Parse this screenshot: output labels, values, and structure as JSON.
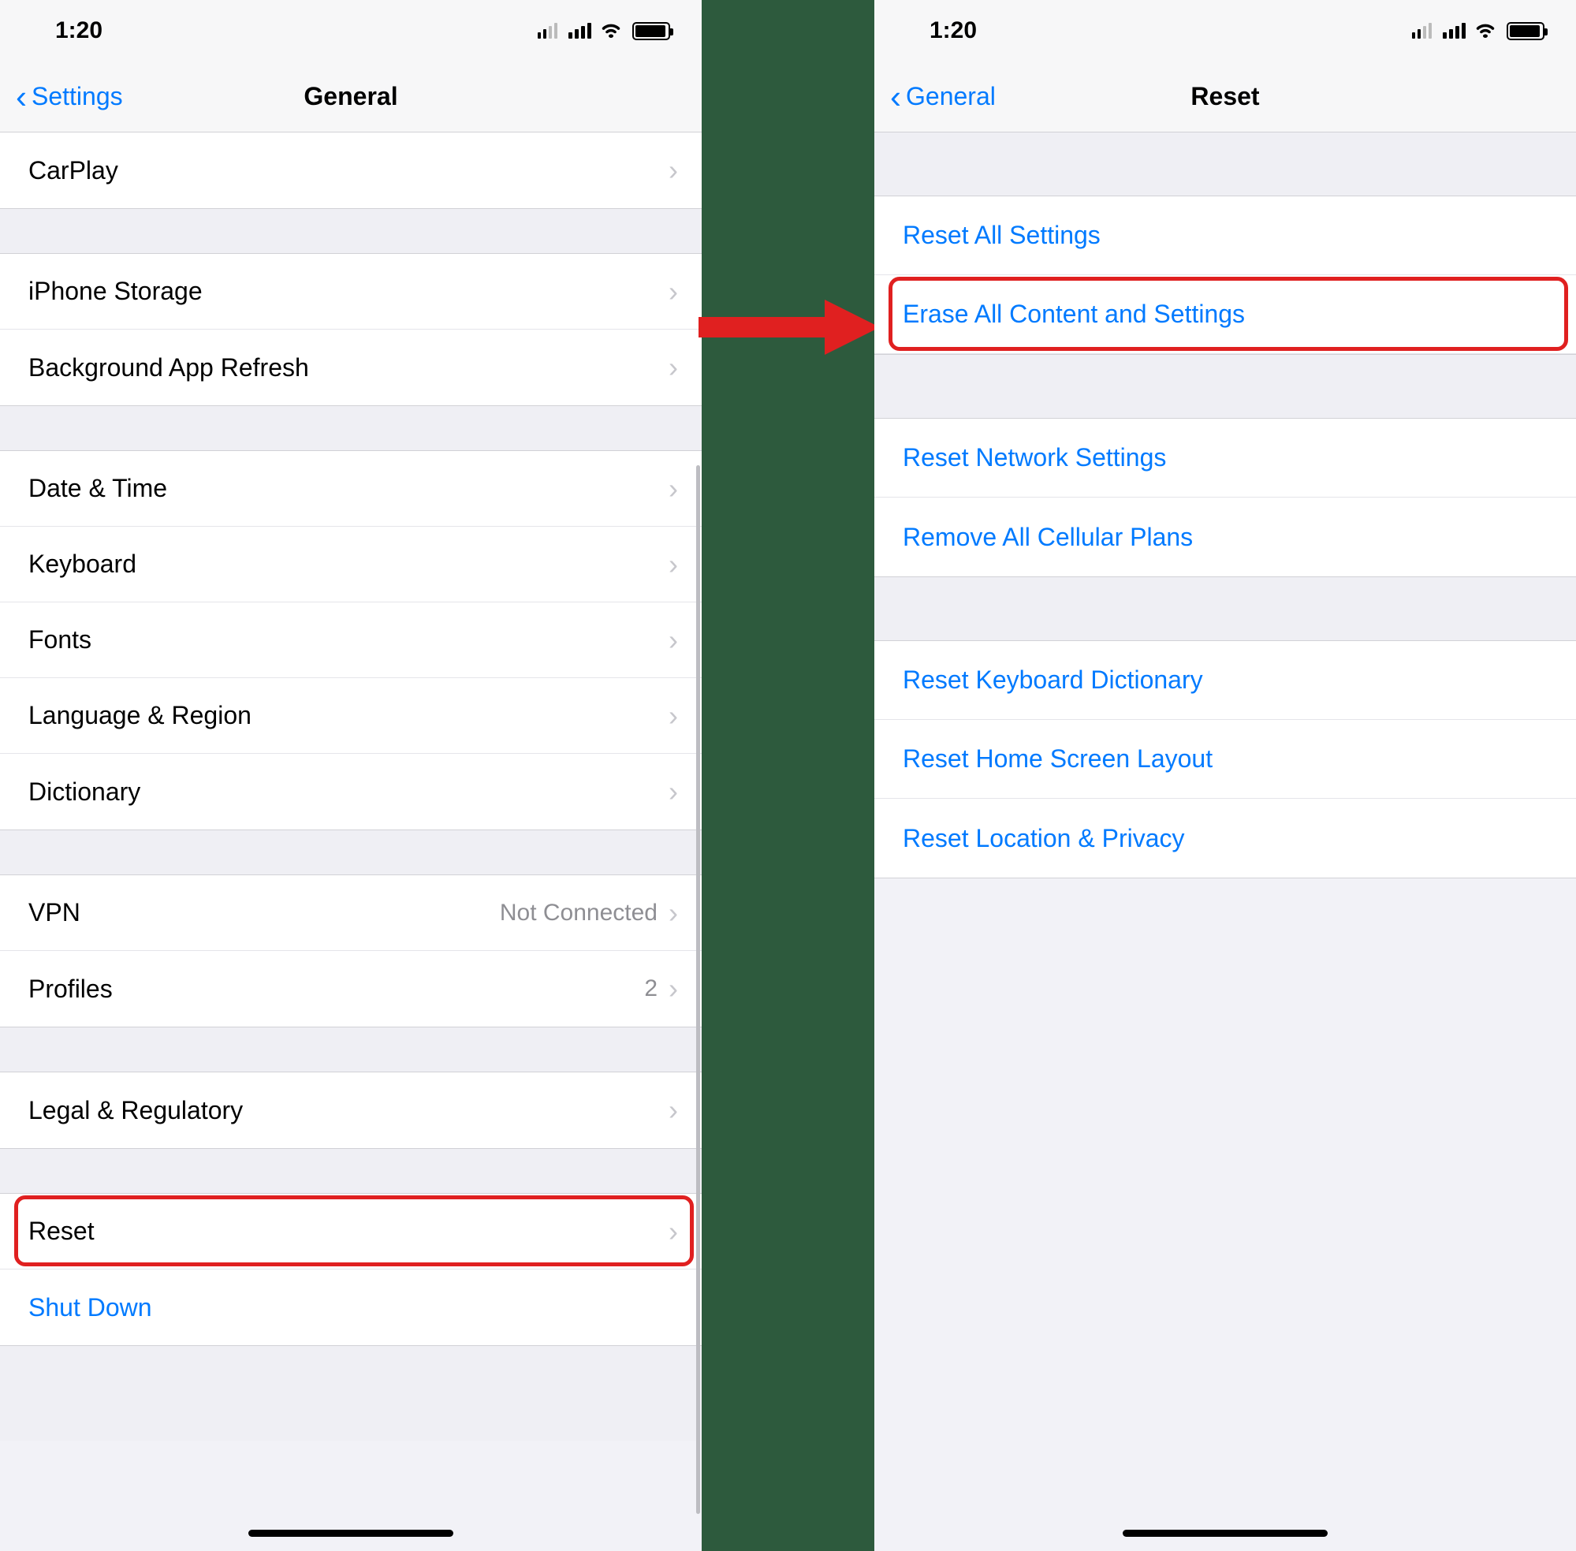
{
  "status": {
    "time": "1:20"
  },
  "left": {
    "nav": {
      "back": "Settings",
      "title": "General"
    },
    "groups": [
      {
        "rows": [
          {
            "label": "CarPlay",
            "chevron": true
          }
        ]
      },
      {
        "rows": [
          {
            "label": "iPhone Storage",
            "chevron": true
          },
          {
            "label": "Background App Refresh",
            "chevron": true
          }
        ]
      },
      {
        "rows": [
          {
            "label": "Date & Time",
            "chevron": true
          },
          {
            "label": "Keyboard",
            "chevron": true
          },
          {
            "label": "Fonts",
            "chevron": true
          },
          {
            "label": "Language & Region",
            "chevron": true
          },
          {
            "label": "Dictionary",
            "chevron": true
          }
        ]
      },
      {
        "rows": [
          {
            "label": "VPN",
            "value": "Not Connected",
            "chevron": true
          },
          {
            "label": "Profiles",
            "value": "2",
            "chevron": true
          }
        ]
      },
      {
        "rows": [
          {
            "label": "Legal & Regulatory",
            "chevron": true
          }
        ]
      },
      {
        "rows": [
          {
            "label": "Reset",
            "chevron": true,
            "highlighted": true
          },
          {
            "label": "Shut Down",
            "link": true
          }
        ]
      }
    ]
  },
  "right": {
    "nav": {
      "back": "General",
      "title": "Reset"
    },
    "groups": [
      {
        "rows": [
          {
            "label": "Reset All Settings"
          },
          {
            "label": "Erase All Content and Settings",
            "highlighted": true
          }
        ]
      },
      {
        "rows": [
          {
            "label": "Reset Network Settings"
          },
          {
            "label": "Remove All Cellular Plans"
          }
        ]
      },
      {
        "rows": [
          {
            "label": "Reset Keyboard Dictionary"
          },
          {
            "label": "Reset Home Screen Layout"
          },
          {
            "label": "Reset Location & Privacy"
          }
        ]
      }
    ]
  }
}
